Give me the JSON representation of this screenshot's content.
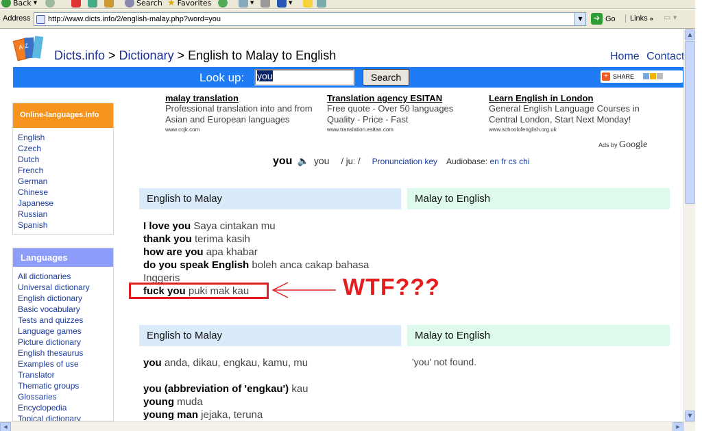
{
  "browser": {
    "back_label": "Back",
    "search_label": "Search",
    "favorites_label": "Favorites",
    "address_label": "Address",
    "url": "http://www.dicts.info/2/english-malay.php?word=you",
    "go_label": "Go",
    "links_label": "Links"
  },
  "header": {
    "site_name": "Dicts.info",
    "sep1": " > ",
    "dictionary": "Dictionary",
    "sep2": " > ",
    "page_title": "English to Malay to English",
    "home": "Home",
    "contact": "Contact"
  },
  "lookup": {
    "label": "Look up:",
    "value": "you",
    "search_button": "Search",
    "share_label": "SHARE"
  },
  "sidebar": {
    "online_title": "Online-languages.info",
    "online_items": [
      "English",
      "Czech",
      "Dutch",
      "French",
      "German",
      "Chinese",
      "Japanese",
      "Russian",
      "Spanish"
    ],
    "languages_title": "Languages",
    "languages_items": [
      "All dictionaries",
      "Universal dictionary",
      "English dictionary",
      "Basic vocabulary",
      "Tests and quizzes",
      "Language games",
      "Picture dictionary",
      "English thesaurus",
      "Examples of use",
      "Translator",
      "Thematic groups",
      "Glossaries",
      "Encyclopedia",
      "Topical dictionary"
    ]
  },
  "ads": [
    {
      "title": "malay translation",
      "body": "Professional translation into and from Asian and European languages",
      "url": "www.ccjk.com"
    },
    {
      "title": "Translation agency ESITAN",
      "body": "Free quote - Over 50 languages Quality - Price - Fast",
      "url": "www.translation.esitan.com"
    },
    {
      "title": "Learn English in London",
      "body": "General English Language Courses in Central London, Start Next Monday!",
      "url": "www.schoolofenglish.org.uk"
    }
  ],
  "ads_by": "Ads by",
  "ads_brand": "Google",
  "pronunciation": {
    "word": "you",
    "spoken": "you",
    "ipa": "/ juː /",
    "key_label": "Pronunciation key",
    "audiobase_label": "Audiobase:",
    "audiobase_langs": "en fr cs chi"
  },
  "section1": {
    "left_header": "English to Malay",
    "right_header": "Malay to English",
    "phrases": [
      {
        "en": "I love you",
        "ms": " Saya cintakan mu"
      },
      {
        "en": "thank you",
        "ms": " terima kasih"
      },
      {
        "en": "how are you",
        "ms": " apa khabar"
      },
      {
        "en": "do you speak English",
        "ms": " boleh anca cakap bahasa"
      },
      {
        "en": "",
        "ms": "Inggeris"
      },
      {
        "en": "fuck you",
        "ms": " puki mak kau"
      }
    ]
  },
  "annotation": {
    "text": "WTF???",
    "color": "#e41e1e"
  },
  "section2": {
    "left_header": "English to Malay",
    "right_header": "Malay to English",
    "definitions": [
      {
        "en": "you",
        "ms": "  anda, dikau, engkau, kamu, mu"
      },
      {
        "en": "you (abbreviation of 'engkau')",
        "ms": "  kau"
      },
      {
        "en": "young",
        "ms": "  muda"
      },
      {
        "en": "young man",
        "ms": "  jejaka, teruna"
      }
    ],
    "not_found": "'you' not found."
  },
  "colors": {
    "lookup_bar": "#1f7bf3",
    "online_header": "#f7941d",
    "languages_header": "#8e9dfa",
    "header_blue": "#dbeafb",
    "header_green": "#ddfaec",
    "link": "#1a3c9e"
  }
}
